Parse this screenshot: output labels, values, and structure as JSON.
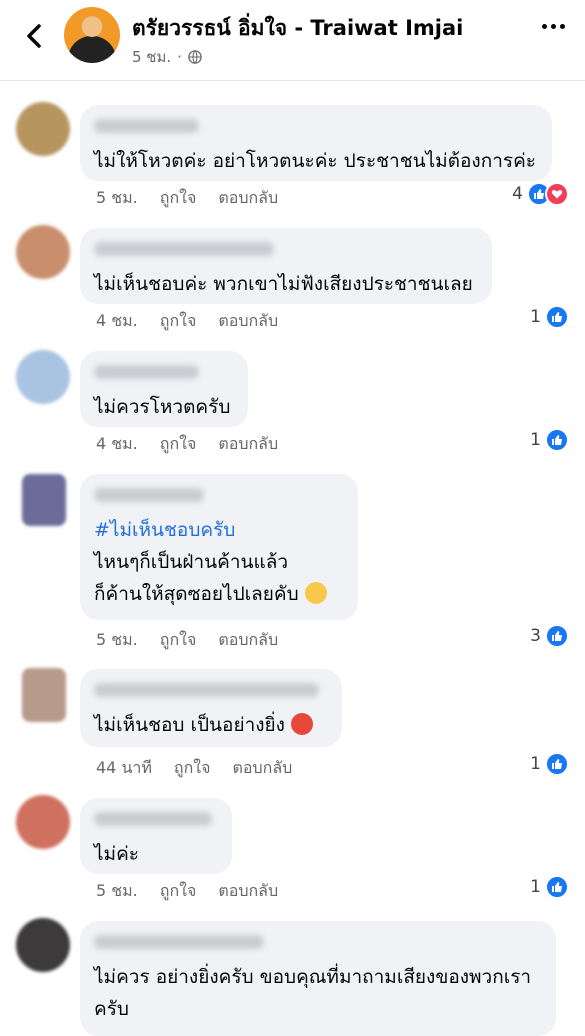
{
  "header": {
    "page_name": "ตรัยวรรธน์ อิ่มใจ - Traiwat Imjai",
    "time": "5 ชม.",
    "separator": "·",
    "icons": {
      "back": "back-arrow-icon",
      "privacy": "globe-icon",
      "more": "more-dots-icon"
    }
  },
  "actions": {
    "like": "ถูกใจ",
    "reply": "ตอบกลับ"
  },
  "comments": [
    {
      "text": "ไม่ให้โหวตค่ะ อย่าโหวตนะค่ะ ประชาชนไม่ต้องการค่ะ",
      "time": "5 ชม.",
      "reaction_count": "4",
      "reactions": [
        "like",
        "love"
      ],
      "avatar_color": "#b7955f"
    },
    {
      "text": "ไม่เห็นชอบค่ะ พวกเขาไม่ฟังเสียงประชาชนเลย",
      "time": "4 ชม.",
      "reaction_count": "1",
      "reactions": [
        "like"
      ],
      "avatar_color": "#c98f6d"
    },
    {
      "text": "ไม่ควรโหวตครับ",
      "time": "4 ชม.",
      "reaction_count": "1",
      "reactions": [
        "like"
      ],
      "avatar_color": "#a9c3e2"
    },
    {
      "hashtag": "#ไม่เห็นชอบครับ",
      "lines": [
        "ไหนๆก็เป็นฝ่านค้านแล้ว",
        "ก็ค้านให้สุดซอยไปเลยคับ"
      ],
      "emoji": "winking-face-emoji",
      "time": "5 ชม.",
      "reaction_count": "3",
      "reactions": [
        "like"
      ],
      "avatar_color": "#6c6c9a"
    },
    {
      "text": "ไม่เห็นชอบ เป็นอย่างยิ่ง",
      "emoji": "angry-face-emoji",
      "time": "44 นาที",
      "reaction_count": "1",
      "reactions": [
        "like"
      ],
      "avatar_color": "#b89a8a"
    },
    {
      "text": "ไม่ค่ะ",
      "time": "5 ชม.",
      "reaction_count": "1",
      "reactions": [
        "like"
      ],
      "avatar_color": "#d0705f"
    },
    {
      "lines": [
        "ไม่ควร อย่างยิ่งครับ ขอบคุณที่มาถามเสียงของพวกเรา",
        "ครับ"
      ],
      "avatar_color": "#3c3a3a"
    }
  ]
}
